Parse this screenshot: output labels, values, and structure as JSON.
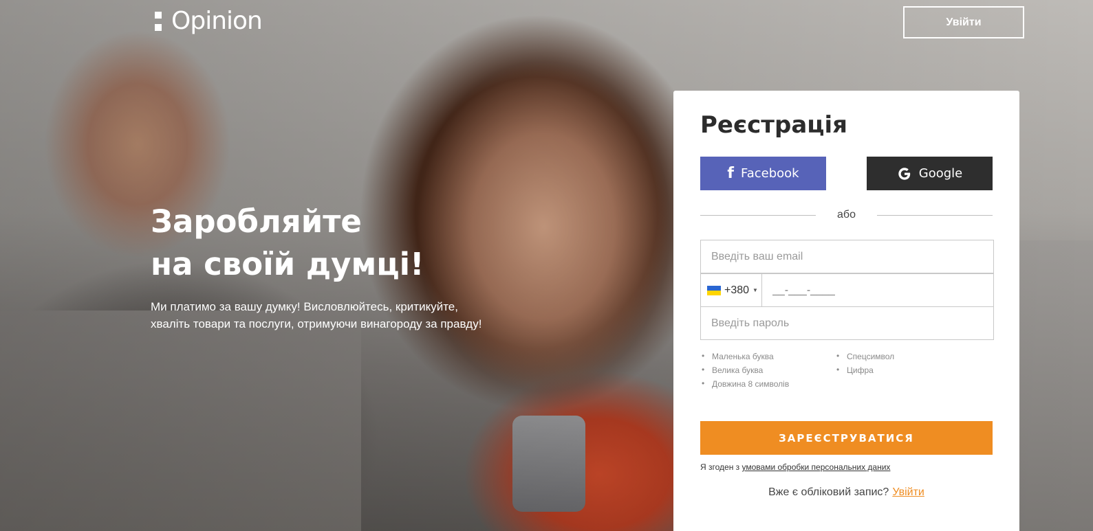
{
  "header": {
    "logo_text": "Opinion",
    "login_label": "Увійти"
  },
  "hero": {
    "title_line1": "Заробляйте",
    "title_line2": "на своїй думці!",
    "subtitle_line1": "Ми платимо за вашу думку! Висловлюйтесь, критикуйте,",
    "subtitle_line2": "хваліть товари та послуги, отримуючи винагороду за правду!"
  },
  "registration": {
    "title": "Реєстрація",
    "facebook_label": "Facebook",
    "google_label": "Google",
    "or_label": "або",
    "email_placeholder": "Введіть ваш email",
    "country_code": "+380",
    "phone_mask": "__-___-____",
    "password_placeholder": "Введіть пароль",
    "password_rules_col1": [
      "Маленька буква",
      "Велика буква",
      "Довжина 8 символів"
    ],
    "password_rules_col2": [
      "Спецсимвол",
      "Цифра"
    ],
    "register_label": "ЗАРЕЄСТРУВАТИСЯ",
    "consent_prefix": "Я згоден з ",
    "consent_link": "умовами обробки персональних даних",
    "have_account_text": "Вже є обліковий запис?",
    "login_link": "Увійти"
  },
  "colors": {
    "facebook": "#5763b8",
    "google": "#2e2e2e",
    "accent": "#ef8d22",
    "flag_blue": "#2a66d1",
    "flag_yellow": "#ffd500"
  }
}
